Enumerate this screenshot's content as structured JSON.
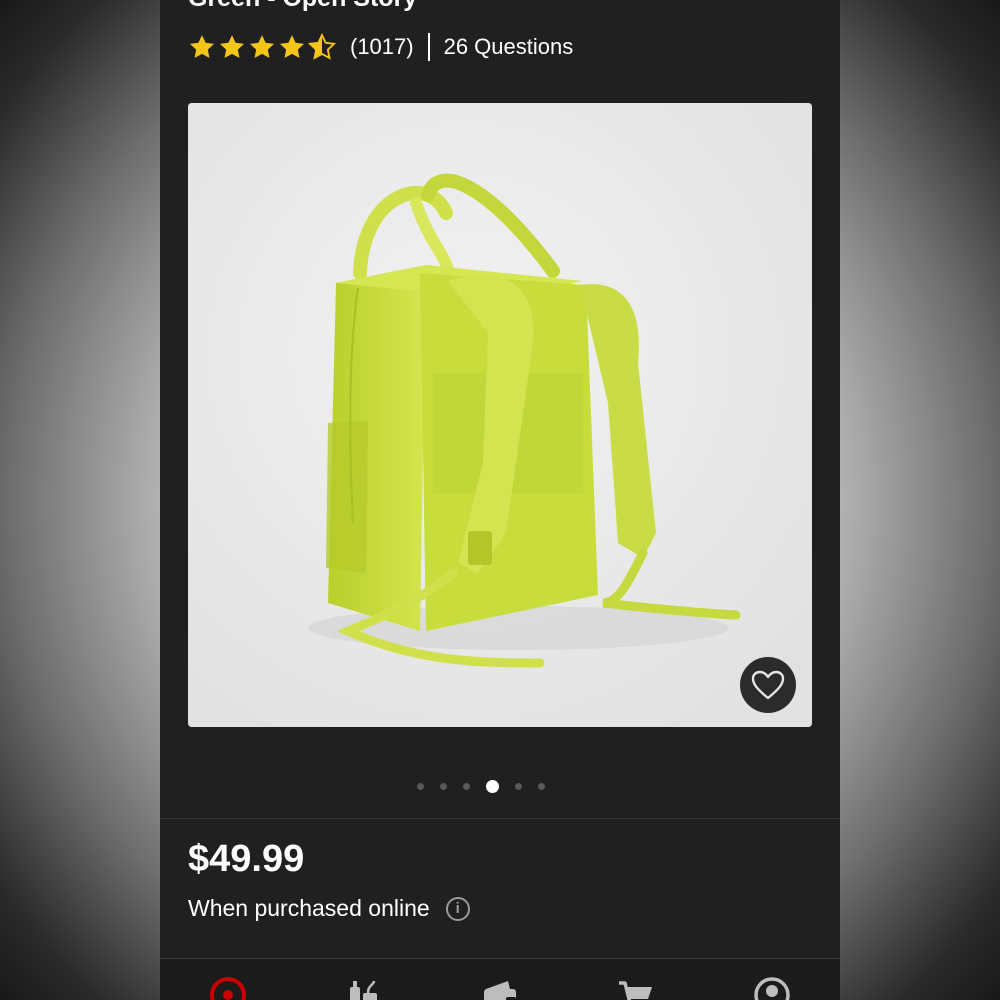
{
  "product": {
    "title": "Green - Open Story™",
    "rating": 4.5,
    "review_count": "(1017)",
    "questions": "26 Questions",
    "image_alt": "Lime green backpack",
    "colors": {
      "bag": "#c8dc3c",
      "accent_star": "#f5c518",
      "brand_red": "#cc0000"
    }
  },
  "gallery": {
    "dot_count": 6,
    "active_index": 3
  },
  "pricing": {
    "price": "$49.99",
    "note": "When purchased online",
    "info_icon_glyph": "i"
  },
  "nav": {
    "items": [
      "home-icon",
      "categories-icon",
      "wallet-icon",
      "cart-icon",
      "account-icon"
    ]
  },
  "icons": {
    "favorite": "heart-icon",
    "star": "star-icon"
  }
}
